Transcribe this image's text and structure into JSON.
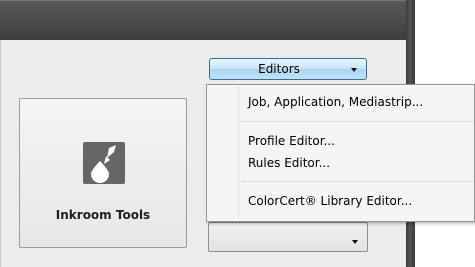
{
  "tool_tile": {
    "label": "Inkroom Tools",
    "icon": "ink-drop-icon"
  },
  "editors_dropdown": {
    "label": "Editors"
  },
  "menu": {
    "items": [
      "Job, Application, Mediastrip...",
      "Profile Editor...",
      "Rules Editor...",
      "ColorCert® Library Editor..."
    ]
  }
}
